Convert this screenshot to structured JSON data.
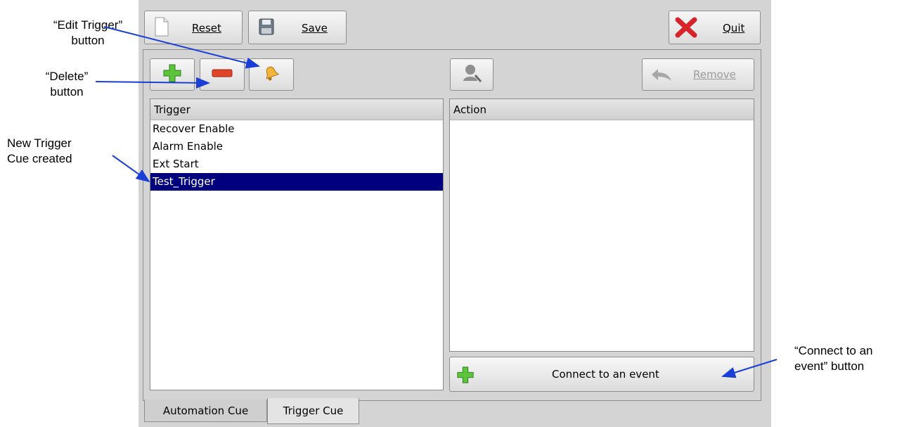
{
  "toolbar": {
    "reset_label": "Reset",
    "save_label": "Save",
    "quit_label": "Quit"
  },
  "trigger_toolbar": {
    "add_icon": "plus-icon",
    "delete_icon": "minus-icon",
    "edit_icon": "bell-icon"
  },
  "action_toolbar": {
    "assign_icon": "user-search-icon",
    "remove_label": "Remove"
  },
  "trigger_list": {
    "header": "Trigger",
    "items": [
      "Recover Enable",
      "Alarm Enable",
      "Ext Start",
      "Test_Trigger"
    ],
    "selected_index": 3
  },
  "action_list": {
    "header": "Action"
  },
  "connect_button": {
    "label": "Connect to an event"
  },
  "tabs": [
    {
      "label": "Automation Cue",
      "active": false
    },
    {
      "label": "Trigger Cue",
      "active": true
    }
  ],
  "annotations": {
    "edit_trigger": [
      "“Edit Trigger”",
      "button"
    ],
    "delete": [
      "“Delete”",
      "button"
    ],
    "new_trigger": [
      "New Trigger",
      "Cue created"
    ],
    "connect_event": [
      "“Connect to an",
      "event” button"
    ]
  },
  "colors": {
    "selection": "#00007e",
    "arrow": "#1a3fd6",
    "plus_green": "#5cc43a",
    "minus_red": "#e0452a",
    "quit_red": "#d8232a"
  }
}
